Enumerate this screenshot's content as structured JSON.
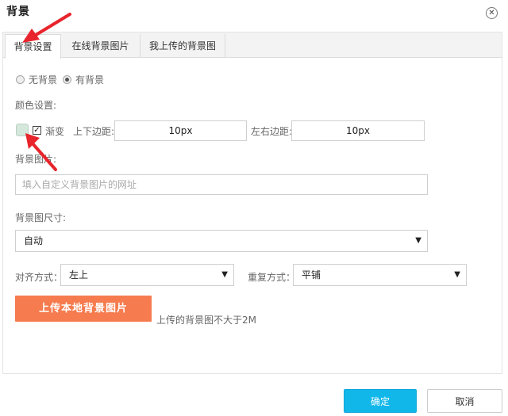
{
  "dialog": {
    "title": "背景",
    "close_glyph": "✕"
  },
  "tabs": [
    {
      "label": "背景设置",
      "active": true
    },
    {
      "label": "在线背景图片",
      "active": false
    },
    {
      "label": "我上传的背景图",
      "active": false
    }
  ],
  "background_mode": {
    "options": [
      {
        "label": "无背景",
        "checked": false
      },
      {
        "label": "有背景",
        "checked": true
      }
    ]
  },
  "color": {
    "label": "颜色设置:",
    "swatch_color": "#d6e8dc",
    "gradient_label": "渐变",
    "gradient_checked": true,
    "vertical_padding_label": "上下边距:",
    "vertical_padding_value": "10px",
    "horizontal_padding_label": "左右边距:",
    "horizontal_padding_value": "10px"
  },
  "image": {
    "label": "背景图片:",
    "url_placeholder": "填入自定义背景图片的网址"
  },
  "size": {
    "label": "背景图尺寸:",
    "value": "自动"
  },
  "align": {
    "label": "对齐方式：",
    "value": "左上"
  },
  "repeat": {
    "label": "重复方式：",
    "value": "平铺"
  },
  "upload": {
    "button_label": "上传本地背景图片",
    "hint": "上传的背景图不大于2M"
  },
  "footer": {
    "ok_label": "确定",
    "cancel_label": "取消"
  },
  "colors": {
    "accent": "#12b7ea",
    "upload": "#f67b4e",
    "annotation": "#e8242c"
  }
}
